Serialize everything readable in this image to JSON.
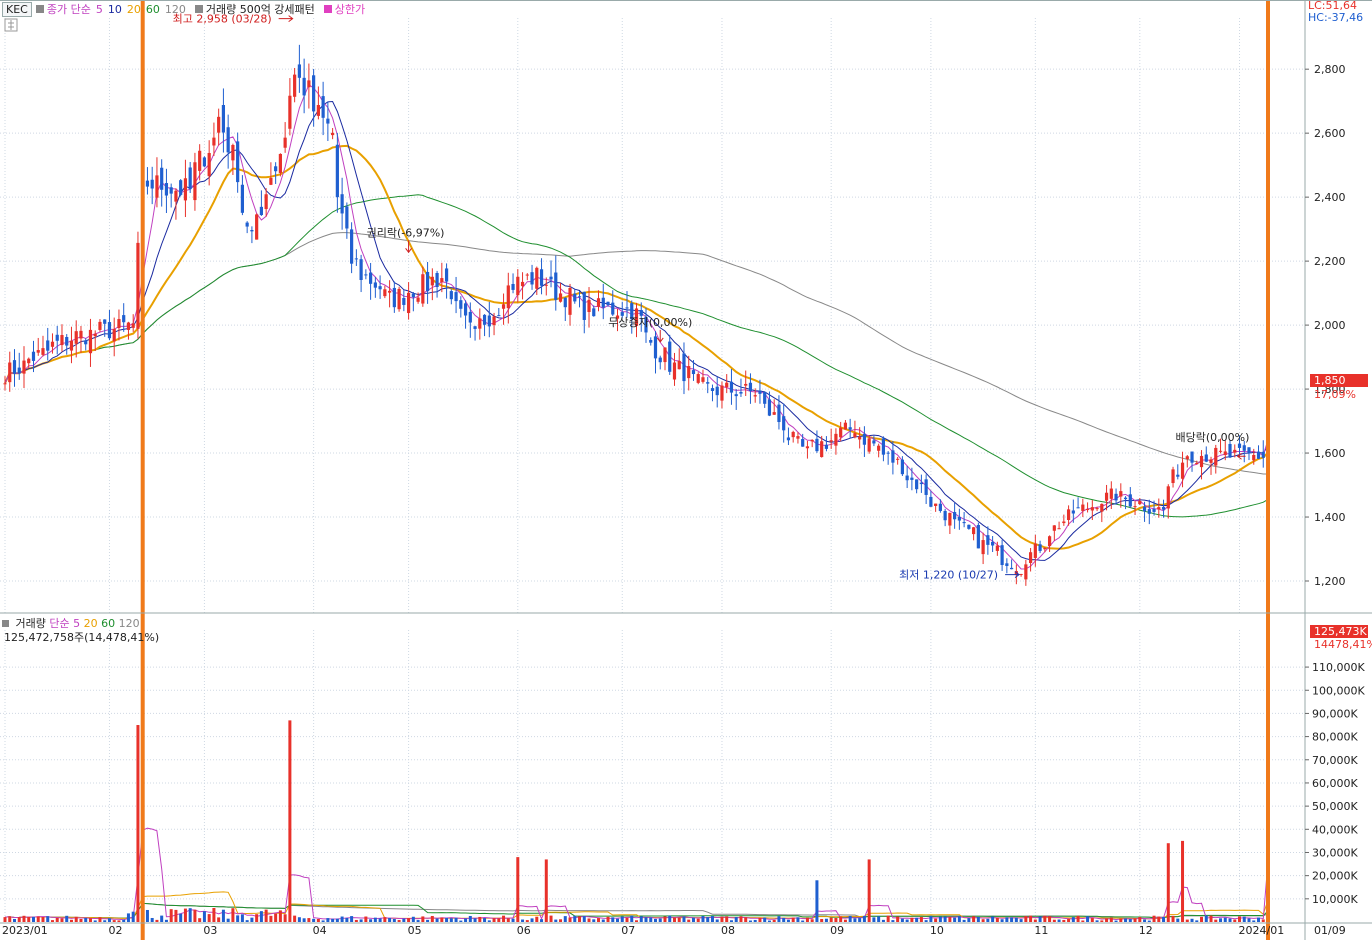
{
  "legend": {
    "ticker": "KEC",
    "ma_label": "종가 단순",
    "ma_periods": [
      "5",
      "10",
      "20",
      "60",
      "120"
    ],
    "ma_colors": [
      "#c040c0",
      "#1a2aa0",
      "#e8a000",
      "#1f8f2f",
      "#888888"
    ],
    "vol_filter": "거래량 500억 강세패턴",
    "upper_limit": "상한가"
  },
  "indicators": {
    "lc": "LC:51,64",
    "hc": "HC:-37,46"
  },
  "price_panel": {
    "current_price": "1,850",
    "change_pct": "17,09%",
    "y_ticks": [
      "2,800",
      "2,600",
      "2,400",
      "2,200",
      "2,000",
      "1,800",
      "1,600",
      "1,400",
      "1,200"
    ],
    "annotations": {
      "high": "최고 2,958 (03/28)",
      "low": "최저 1,220 (10/27)",
      "rights": "권리락(-6,97%)",
      "capital": "무상증자(0,00%)",
      "dividend": "배당락(0,00%)"
    }
  },
  "volume_panel": {
    "title": "거래량",
    "ma_label": "단순",
    "ma_periods": [
      "5",
      "20",
      "60",
      "120"
    ],
    "ma_colors": [
      "#c040c0",
      "#e8a000",
      "#1f8f2f",
      "#888888"
    ],
    "summary": "125,472,758주(14,478,41%)",
    "current_volume": "125,473K",
    "change_pct": "14478,41%",
    "y_ticks": [
      "110,000K",
      "100,000K",
      "90,000K",
      "80,000K",
      "70,000K",
      "60,000K",
      "50,000K",
      "40,000K",
      "30,000K",
      "20,000K",
      "10,000K"
    ]
  },
  "x_ticks": [
    "2023/01",
    "02",
    "03",
    "04",
    "05",
    "06",
    "07",
    "08",
    "09",
    "10",
    "11",
    "12",
    "2024/01",
    "01/09"
  ],
  "colors": {
    "up": "#e8312a",
    "down": "#1f5fd0",
    "highlight": "#f07a1a",
    "grid": "#cfd8e3"
  },
  "chart_data": {
    "type": "candlestick",
    "price_anchors": [
      [
        "2023-01-02",
        1850
      ],
      [
        "2023-01-20",
        1960
      ],
      [
        "2023-02-08",
        2000
      ],
      [
        "2023-02-10",
        2450
      ],
      [
        "2023-02-24",
        2420
      ],
      [
        "2023-03-06",
        2650
      ],
      [
        "2023-03-15",
        2280
      ],
      [
        "2023-03-22",
        2500
      ],
      [
        "2023-03-28",
        2780
      ],
      [
        "2023-04-07",
        2600
      ],
      [
        "2023-04-13",
        2200
      ],
      [
        "2023-04-25",
        2080
      ],
      [
        "2023-05-10",
        2150
      ],
      [
        "2023-05-19",
        1960
      ],
      [
        "2023-05-31",
        2130
      ],
      [
        "2023-06-07",
        2150
      ],
      [
        "2023-06-21",
        2050
      ],
      [
        "2023-07-05",
        2050
      ],
      [
        "2023-07-13",
        1910
      ],
      [
        "2023-07-27",
        1800
      ],
      [
        "2023-08-10",
        1790
      ],
      [
        "2023-08-25",
        1600
      ],
      [
        "2023-09-08",
        1680
      ],
      [
        "2023-09-22",
        1560
      ],
      [
        "2023-10-06",
        1400
      ],
      [
        "2023-10-27",
        1240
      ],
      [
        "2023-11-10",
        1400
      ],
      [
        "2023-11-24",
        1470
      ],
      [
        "2023-12-08",
        1420
      ],
      [
        "2023-12-15",
        1600
      ],
      [
        "2023-12-28",
        1590
      ],
      [
        "2024-01-08",
        1590
      ],
      [
        "2024-01-09",
        1850
      ]
    ],
    "volume_spikes": [
      [
        "2023-02-09",
        85000
      ],
      [
        "2023-02-10",
        104000
      ],
      [
        "2023-03-27",
        87000
      ],
      [
        "2023-06-01",
        28000
      ],
      [
        "2023-06-09",
        27000
      ],
      [
        "2023-08-29",
        18000
      ],
      [
        "2023-09-13",
        27000
      ],
      [
        "2023-12-11",
        34000
      ],
      [
        "2023-12-14",
        35000
      ],
      [
        "2024-01-09",
        125473
      ]
    ],
    "high": {
      "date": "2023-03-28",
      "value": 2958
    },
    "low": {
      "date": "2023-10-27",
      "value": 1220
    },
    "current_close": 1850,
    "current_volume_k": 125473,
    "y_range_price": [
      1100,
      2960
    ],
    "y_range_volume_k": [
      0,
      126000
    ],
    "grid": true
  }
}
